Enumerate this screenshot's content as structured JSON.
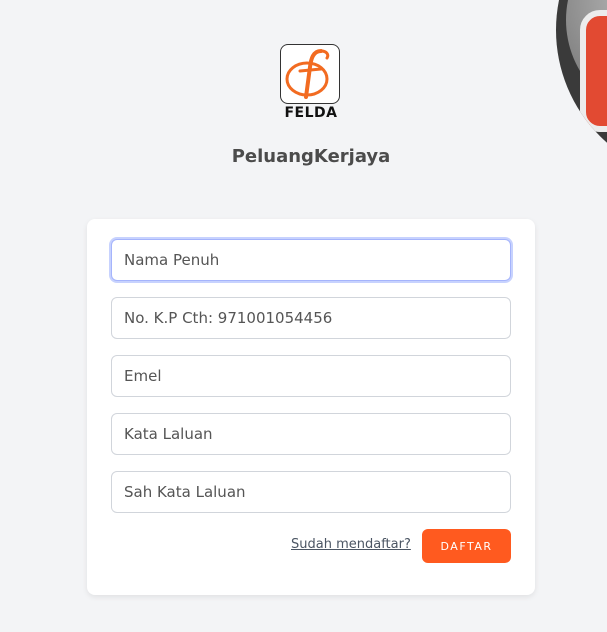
{
  "brand": {
    "logo_text": "FELDA",
    "app_title": "PeluangKerjaya",
    "accent_color": "#ff5a1f",
    "logo_color": "#f26b21"
  },
  "form": {
    "fields": [
      {
        "placeholder": "Nama Penuh",
        "value": ""
      },
      {
        "placeholder": "No. K.P Cth: 971001054456",
        "value": ""
      },
      {
        "placeholder": "Emel",
        "value": ""
      },
      {
        "placeholder": "Kata Laluan",
        "value": ""
      },
      {
        "placeholder": "Sah Kata Laluan",
        "value": ""
      }
    ],
    "login_link": "Sudah mendaftar?",
    "submit_label": "DAFTAR"
  }
}
